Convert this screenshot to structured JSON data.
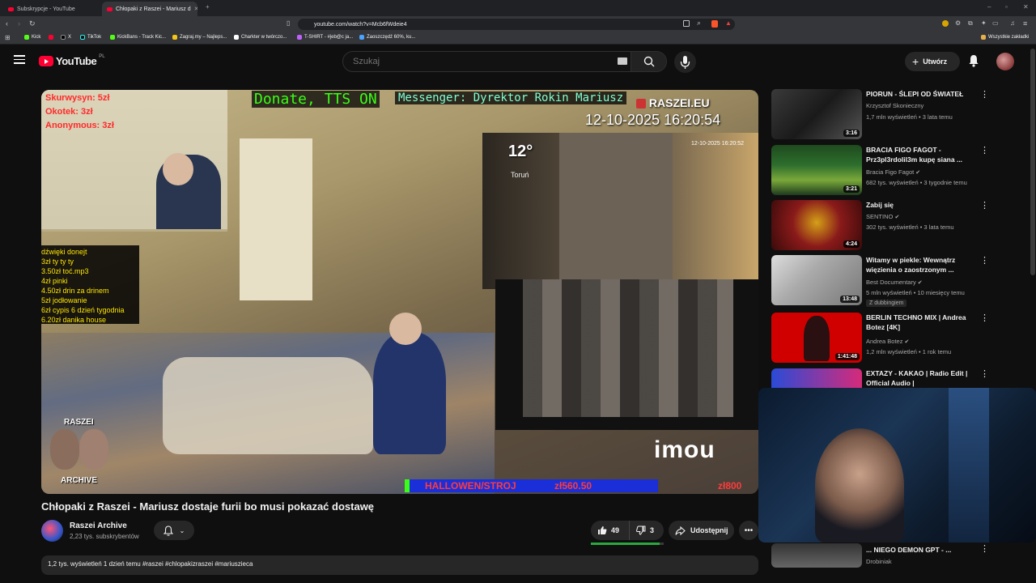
{
  "browser": {
    "tabs": [
      {
        "title": "Subskrypcje - YouTube"
      },
      {
        "title": "Chłopaki z Raszei - Mariusz d"
      }
    ],
    "url": "youtube.com/watch?v=Mcb6fWdeie4",
    "bookmarks": [
      "Kick",
      "X",
      "TikTok",
      "KickBans - Track Kic...",
      "Zagraj.my – Najleps...",
      "Charkter w twórczo...",
      "T-SHIRT - #jeb@c ja...",
      "Zaoszczędź 60%, ku..."
    ],
    "all_bookmarks": "Wszystkie zakładki"
  },
  "header": {
    "logo_text": "YouTube",
    "region": "PL",
    "search_placeholder": "Szukaj",
    "create_label": "Utwórz"
  },
  "video": {
    "overlay": {
      "donors": [
        "Skurwysyn: 5zł",
        "Okotek: 3zł",
        "Anonymous: 3zł"
      ],
      "donate_banner": "Donate, TTS ON",
      "messenger": "Messenger: Dyrektor Rokin Mariusz",
      "site": "RASZEI.EU",
      "datetime": "12-10-2025 16:20:54",
      "temp": "12°",
      "city": "Toruń",
      "cam_datetime": "12-10-2025 16:20:52",
      "sounds": [
        "dźwięki donejt",
        "3zł ty ty ty",
        "3.50zł toć.mp3",
        "4zł pinki",
        "4.50zł drin za drinem",
        "5zł jodłowanie",
        "6zł cypis 6 dzień tygodnia",
        "6.20zł danika house"
      ],
      "raszei_label": "RASZEI",
      "archive_label": "ARCHIVE",
      "brand": "imou",
      "goal": "HALLOWEN/STROJ",
      "goal_amount": "zł560.50",
      "goal_target": "zł800"
    },
    "title": "Chłopaki z Raszei - Mariusz dostaje furii bo musi pokazać dostawę",
    "channel": {
      "name": "Raszei Archive",
      "subs": "2,23 tys. subskrybentów"
    },
    "likes": "49",
    "dislikes": "3",
    "share_label": "Udostępnij",
    "description": "1,2 tys. wyświetleń  1 dzień temu  #raszei #chlopakizraszei #mariuszieca"
  },
  "recommendations": [
    {
      "title": "PIORUN - ŚLEPI OD ŚWIATEŁ",
      "channel": "Krzysztof Skonieczny",
      "meta": "1,7 mln wyświetleń • 3 lata temu",
      "duration": "3:16",
      "verified": false
    },
    {
      "title": "BRACIA FIGO FAGOT - Prz3pl3rdolil3m kupę siana ...",
      "channel": "Bracia Figo Fagot",
      "meta": "682 tys. wyświetleń • 3 tygodnie temu",
      "duration": "3:21",
      "verified": true
    },
    {
      "title": "Zabij się",
      "channel": "SENTINO",
      "meta": "302 tys. wyświetleń • 3 lata temu",
      "duration": "4:24",
      "verified": true
    },
    {
      "title": "Witamy w piekle: Wewnątrz więzienia o zaostrzonym ...",
      "channel": "Best Documentary",
      "meta": "5 mln wyświetleń • 10 miesięcy temu",
      "duration": "13:48",
      "verified": true,
      "badge": "Z dubbingiem"
    },
    {
      "title": "BERLIN TECHNO MIX | Andrea Botez [4K]",
      "channel": "Andrea Botez",
      "meta": "1,2 mln wyświetleń • 1 rok temu",
      "duration": "1:41:48",
      "verified": true
    },
    {
      "title": "EXTAZY - KAKAO | Radio Edit | Official Audio |",
      "channel": "",
      "meta": "",
      "duration": "",
      "verified": false
    },
    {
      "title": "... NIEGO DEMON GPT - ...",
      "channel": "Drobiniak",
      "meta": "",
      "duration": "",
      "verified": false
    }
  ],
  "icons": {
    "menu": "menu-icon",
    "search": "search-icon",
    "mic": "mic-icon",
    "bell": "bell-icon",
    "like": "thumb-up-icon",
    "dislike": "thumb-down-icon",
    "share": "share-icon"
  },
  "colors": {
    "brand_red": "#ff0033",
    "bg": "#0f0f0f",
    "chip": "#272727",
    "accent_green": "#2ba640"
  }
}
